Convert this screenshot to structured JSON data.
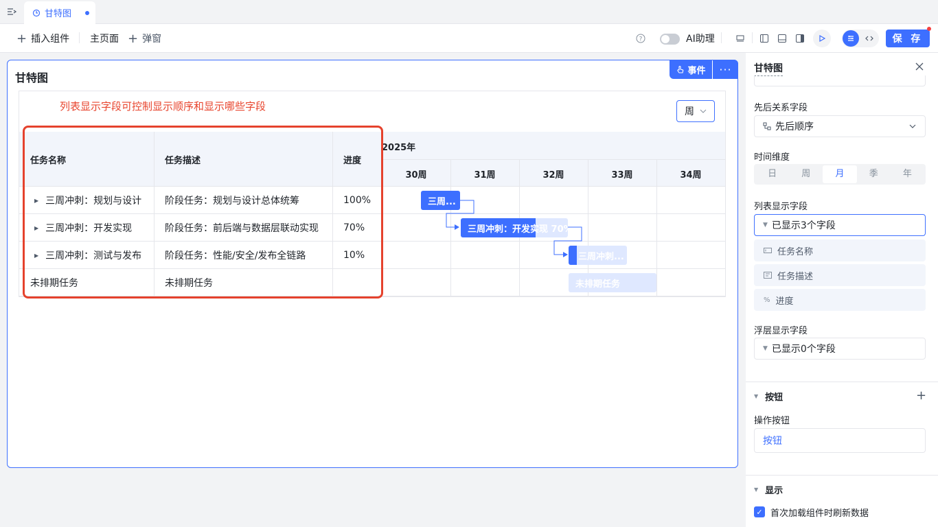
{
  "tab": {
    "title": "甘特图"
  },
  "toolbar": {
    "insert_label": "插入组件",
    "home_label": "主页面",
    "popup_label": "弹窗",
    "ai_label": "AI助理",
    "save_label": "保 存"
  },
  "component": {
    "title": "甘特图",
    "event_label": "事件",
    "annotation": "列表显示字段可控制显示顺序和显示哪些字段",
    "week_select": "周",
    "year_label": "2025年",
    "columns": [
      "任务名称",
      "任务描述",
      "进度"
    ],
    "weeks": [
      "30周",
      "31周",
      "32周",
      "33周",
      "34周"
    ],
    "rows": [
      {
        "name": "三周冲刺：规划与设计",
        "desc": "阶段任务：规划与设计总体统筹",
        "progress": "100%"
      },
      {
        "name": "三周冲刺：开发实现",
        "desc": "阶段任务：前后端与数据层联动实现",
        "progress": "70%"
      },
      {
        "name": "三周冲刺：测试与发布",
        "desc": "阶段任务：性能/安全/发布全链路",
        "progress": "10%"
      },
      {
        "name": "未排期任务",
        "desc": "未排期任务",
        "progress": ""
      }
    ],
    "bars": [
      {
        "label": "三周...",
        "progress": 1.0
      },
      {
        "label": "三周冲刺：开发实现 70%",
        "progress": 0.7
      },
      {
        "label": "三周冲刺...",
        "progress": 0.1
      },
      {
        "label": "未排期任务",
        "progress": 0
      }
    ]
  },
  "panel": {
    "title": "甘特图",
    "dependency_label": "先后关系字段",
    "dependency_value": "先后顺序",
    "time_dim_label": "时间维度",
    "time_dims": [
      "日",
      "周",
      "月",
      "季",
      "年"
    ],
    "time_dim_selected": "月",
    "list_fields_label": "列表显示字段",
    "list_fields_value": "已显示3个字段",
    "list_fields": [
      "任务名称",
      "任务描述",
      "进度"
    ],
    "float_fields_label": "浮层显示字段",
    "float_fields_value": "已显示0个字段",
    "button_section": "按钮",
    "action_button_label": "操作按钮",
    "action_button_value": "按钮",
    "display_section": "显示",
    "refresh_label": "首次加载组件时刷新数据"
  },
  "colors": {
    "accent": "#3d6fff",
    "annotation": "#e5422d",
    "bar_light": "#dfe8ff"
  }
}
